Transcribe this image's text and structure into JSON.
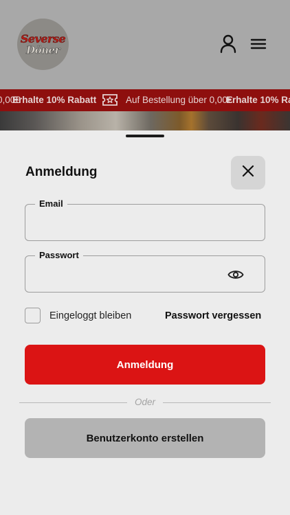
{
  "header": {
    "logo_line1": "Severse",
    "logo_line2": "Döner",
    "account_icon": "user-icon",
    "menu_icon": "hamburger-menu-icon"
  },
  "banner": {
    "items": [
      {
        "text": "0,00€"
      },
      {
        "text": "Erhalte 10% Rabatt"
      },
      {
        "text": "Auf Bestellung über 0,00€"
      },
      {
        "text": "Erhalte 10% Ra"
      }
    ],
    "icon": "ticket-star-icon",
    "color": "#8e0f0e"
  },
  "login": {
    "title": "Anmeldung",
    "close_icon": "close-icon",
    "email": {
      "label": "Email",
      "value": "",
      "placeholder": ""
    },
    "password": {
      "label": "Passwort",
      "value": "",
      "placeholder": "",
      "toggle_icon": "eye-icon"
    },
    "remember_label": "Eingeloggt bleiben",
    "remember_checked": false,
    "forgot_label": "Passwort vergessen",
    "submit_label": "Anmeldung",
    "divider_label": "Oder",
    "register_label": "Benutzerkonto erstellen"
  },
  "colors": {
    "accent": "#db1414",
    "sheet_bg": "#ececec",
    "secondary_button": "#b3b3b3"
  }
}
